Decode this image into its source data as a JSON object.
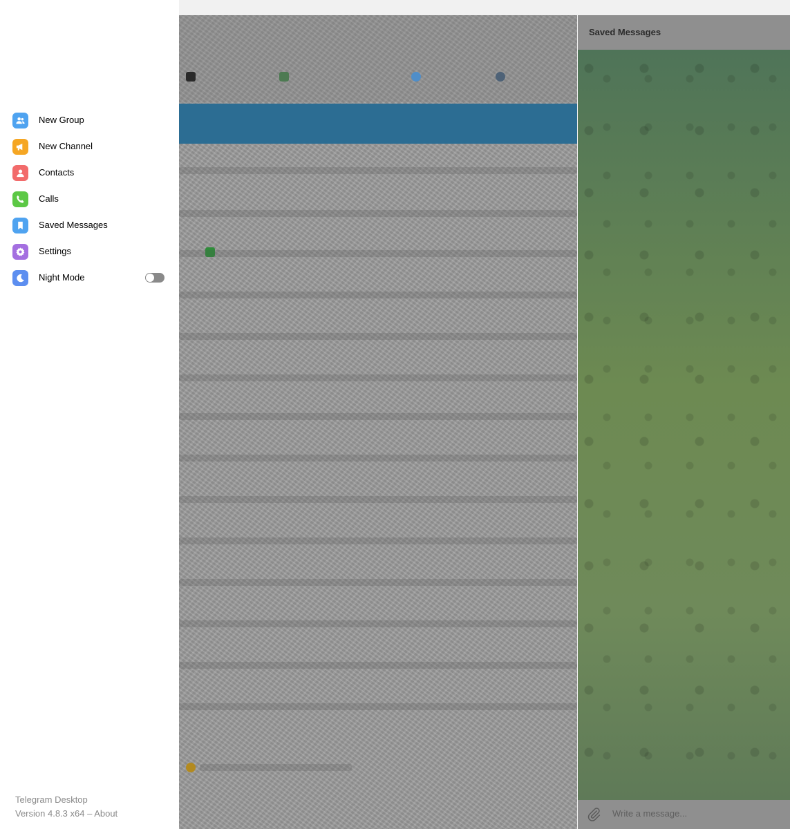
{
  "drawer": {
    "menu": [
      {
        "label": "New Group",
        "icon": "group-icon",
        "color": "#4fa3f0"
      },
      {
        "label": "New Channel",
        "icon": "megaphone-icon",
        "color": "#f5a623"
      },
      {
        "label": "Contacts",
        "icon": "person-icon",
        "color": "#f26b6b"
      },
      {
        "label": "Calls",
        "icon": "phone-icon",
        "color": "#5cc845"
      },
      {
        "label": "Saved Messages",
        "icon": "bookmark-icon",
        "color": "#4fa3f0"
      },
      {
        "label": "Settings",
        "icon": "gear-icon",
        "color": "#a46fe0"
      },
      {
        "label": "Night Mode",
        "icon": "moon-icon",
        "color": "#5c8ef0"
      }
    ],
    "night_mode_enabled": false,
    "footer": {
      "app_name": "Telegram Desktop",
      "version": "Version 4.8.3 x64 – About"
    }
  },
  "chat": {
    "title": "Saved Messages",
    "composer_placeholder": "Write a message..."
  },
  "colors": {
    "selected_chat": "#2c6d93",
    "chat_background": "#5f7a58"
  }
}
